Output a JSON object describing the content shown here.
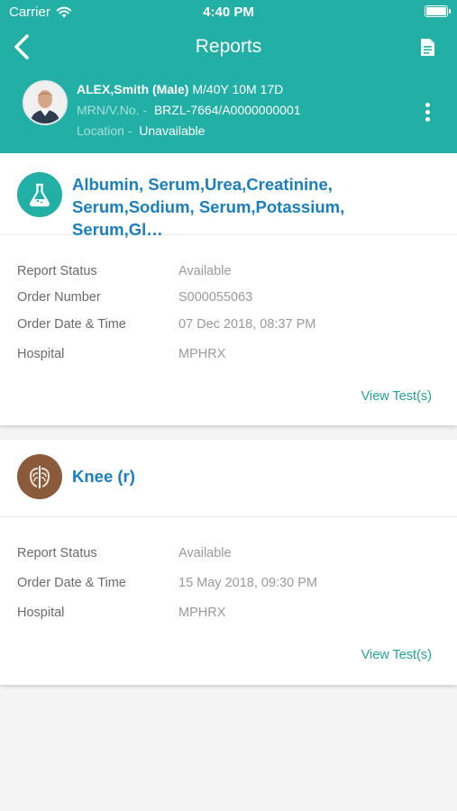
{
  "status_bar": {
    "carrier": "Carrier",
    "time": "4:40 PM"
  },
  "nav": {
    "title": "Reports"
  },
  "patient": {
    "name": "ALEX,Smith (Male)",
    "age": "M/40Y 10M 17D",
    "mrn_label": "MRN/V.No. -",
    "mrn_value": "BRZL-7664/A0000000001",
    "location_label": "Location -",
    "location_value": "Unavailable"
  },
  "reports": [
    {
      "icon": "flask-icon",
      "icon_color": "#22b0a6",
      "title": "Albumin, Serum,Urea,Creatinine, Serum,Sodium, Serum,Potassium, Serum,Gl…",
      "fields": [
        {
          "label": "Report Status",
          "value": "Available"
        },
        {
          "label": "Order Number",
          "value": "S000055063"
        },
        {
          "label": "Order Date & Time",
          "value": "07 Dec 2018, 08:37 PM"
        },
        {
          "label": "Hospital",
          "value": "MPHRX"
        }
      ],
      "link": "View Test(s)"
    },
    {
      "icon": "ribcage-icon",
      "icon_color": "#8a5a3b",
      "title": "Knee (r)",
      "fields": [
        {
          "label": "Report Status",
          "value": "Available"
        },
        {
          "label": "Order Date & Time",
          "value": "15 May 2018, 09:30 PM"
        },
        {
          "label": "Hospital",
          "value": "MPHRX"
        }
      ],
      "link": "View Test(s)"
    }
  ],
  "colors": {
    "header": "#22b0a6",
    "title_blue": "#1a7fbf",
    "link_teal": "#22a49b"
  }
}
